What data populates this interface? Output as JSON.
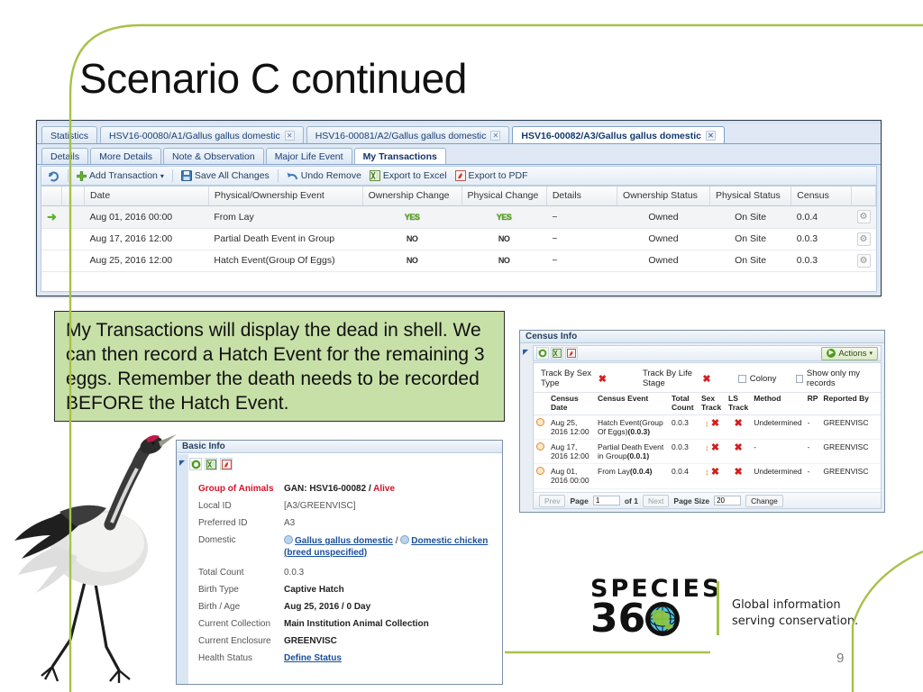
{
  "slide": {
    "title": "Scenario C continued",
    "page_number": "9",
    "accent_green": "#a8c14a",
    "callout_bg": "#c7e0a8"
  },
  "callout": {
    "text": "My Transactions will display the dead in shell. We can then record a Hatch Event for the remaining 3 eggs. Remember the death needs to be recorded BEFORE the Hatch Event."
  },
  "txn_window": {
    "record_tabs": [
      {
        "label": "Statistics",
        "closable": false,
        "active": false
      },
      {
        "label": "HSV16-00080/A1/Gallus gallus domestic",
        "closable": true,
        "active": false
      },
      {
        "label": "HSV16-00081/A2/Gallus gallus domestic",
        "closable": true,
        "active": false
      },
      {
        "label": "HSV16-00082/A3/Gallus gallus domestic",
        "closable": true,
        "active": true
      }
    ],
    "sub_tabs": [
      {
        "label": "Details",
        "active": false
      },
      {
        "label": "More Details",
        "active": false
      },
      {
        "label": "Note & Observation",
        "active": false
      },
      {
        "label": "Major Life Event",
        "active": false
      },
      {
        "label": "My Transactions",
        "active": true
      }
    ],
    "toolbar": {
      "refresh_icon": "refresh-icon",
      "add_transaction": "Add Transaction",
      "add_transaction_caret": "▾",
      "save_all_changes": "Save All Changes",
      "undo_remove": "Undo Remove",
      "export_to_excel": "Export to Excel",
      "export_to_pdf": "Export to PDF"
    },
    "table": {
      "columns": [
        "",
        "",
        "Date",
        "Physical/Ownership Event",
        "Ownership Change",
        "Physical Change",
        "Details",
        "Ownership Status",
        "Physical Status",
        "Census",
        ""
      ],
      "rows": [
        {
          "selected": true,
          "marker": "➜",
          "date": "Aug 01, 2016 00:00",
          "event": "From Lay",
          "ownership_change": "YES",
          "physical_change": "YES",
          "details": "~",
          "ownership_status": "Owned",
          "physical_status": "On Site",
          "census": "0.0.4"
        },
        {
          "selected": false,
          "marker": "",
          "date": "Aug 17, 2016 12:00",
          "event": "Partial Death Event in Group",
          "ownership_change": "NO",
          "physical_change": "NO",
          "details": "~",
          "ownership_status": "Owned",
          "physical_status": "On Site",
          "census": "0.0.3"
        },
        {
          "selected": false,
          "marker": "",
          "date": "Aug 25, 2016 12:00",
          "event": "Hatch Event(Group Of Eggs)",
          "ownership_change": "NO",
          "physical_change": "NO",
          "details": "~",
          "ownership_status": "Owned",
          "physical_status": "On Site",
          "census": "0.0.3"
        }
      ]
    }
  },
  "census_info": {
    "title": "Census Info",
    "actions_label": "Actions",
    "actions_caret": "▾",
    "filters": {
      "track_by_sex_type": "Track By Sex Type",
      "track_by_life_stage": "Track By Life Stage",
      "colony": "Colony",
      "show_only_my_records": "Show only my records"
    },
    "columns": [
      "",
      "Census Date",
      "Census Event",
      "Total Count",
      "Sex Track",
      "LS Track",
      "Method",
      "RP",
      "Reported By"
    ],
    "rows": [
      {
        "date": "Aug 25, 2016 12:00",
        "event": "Hatch Event(Group Of Eggs)",
        "event_count": "(0.0.3)",
        "total_count": "0.0.3",
        "method": "Undetermined",
        "rp": "-",
        "reported_by": "GREENVISC"
      },
      {
        "date": "Aug 17, 2016 12:00",
        "event": "Partial Death Event in Group",
        "event_count": "(0.0.1)",
        "total_count": "0.0.3",
        "method": "-",
        "rp": "-",
        "reported_by": "GREENVISC"
      },
      {
        "date": "Aug 01, 2016 00:00",
        "event": "From Lay",
        "event_count": "(0.0.4)",
        "total_count": "0.0.4",
        "method": "Undetermined",
        "rp": "-",
        "reported_by": "GREENVISC"
      }
    ],
    "pager": {
      "prev": "Prev",
      "page_label": "Page",
      "page_value": "1",
      "of_label": "of 1",
      "next": "Next",
      "page_size_label": "Page Size",
      "page_size_value": "20",
      "change": "Change"
    }
  },
  "basic_info": {
    "title": "Basic Info",
    "rows": [
      {
        "label": "Group of Animals",
        "value": "GAN: HSV16-00082 / Alive",
        "label_red": true
      },
      {
        "label": "Local ID",
        "value": "[A3/GREENVISC]",
        "plain": true
      },
      {
        "label": "Preferred ID",
        "value": "A3",
        "plain": true
      },
      {
        "label": "Domestic",
        "value": "Gallus gallus domestic / Domestic chicken (breed unspecified)",
        "link": true
      },
      {
        "label": "Total Count",
        "value": "0.0.3",
        "plain": true
      },
      {
        "label": "Birth Type",
        "value": "Captive Hatch"
      },
      {
        "label": "Birth / Age",
        "value": "Aug 25, 2016 / 0 Day"
      },
      {
        "label": "Current Collection",
        "value": "Main Institution Animal Collection"
      },
      {
        "label": "Current Enclosure",
        "value": "GREENVISC"
      },
      {
        "label": "Health Status",
        "value": "Define Status",
        "link": true
      }
    ],
    "domestic_links": {
      "first": "Gallus gallus domestic",
      "separator": "/",
      "second": "Domestic chicken",
      "second_line2": "(breed unspecified)"
    },
    "gan_prefix": "GAN: HSV16-00082",
    "gan_sep": "/",
    "gan_status": "Alive"
  },
  "logo": {
    "line1": "SPECIES",
    "line2": "36",
    "tagline_line1": "Global information",
    "tagline_line2": "serving conservation."
  }
}
